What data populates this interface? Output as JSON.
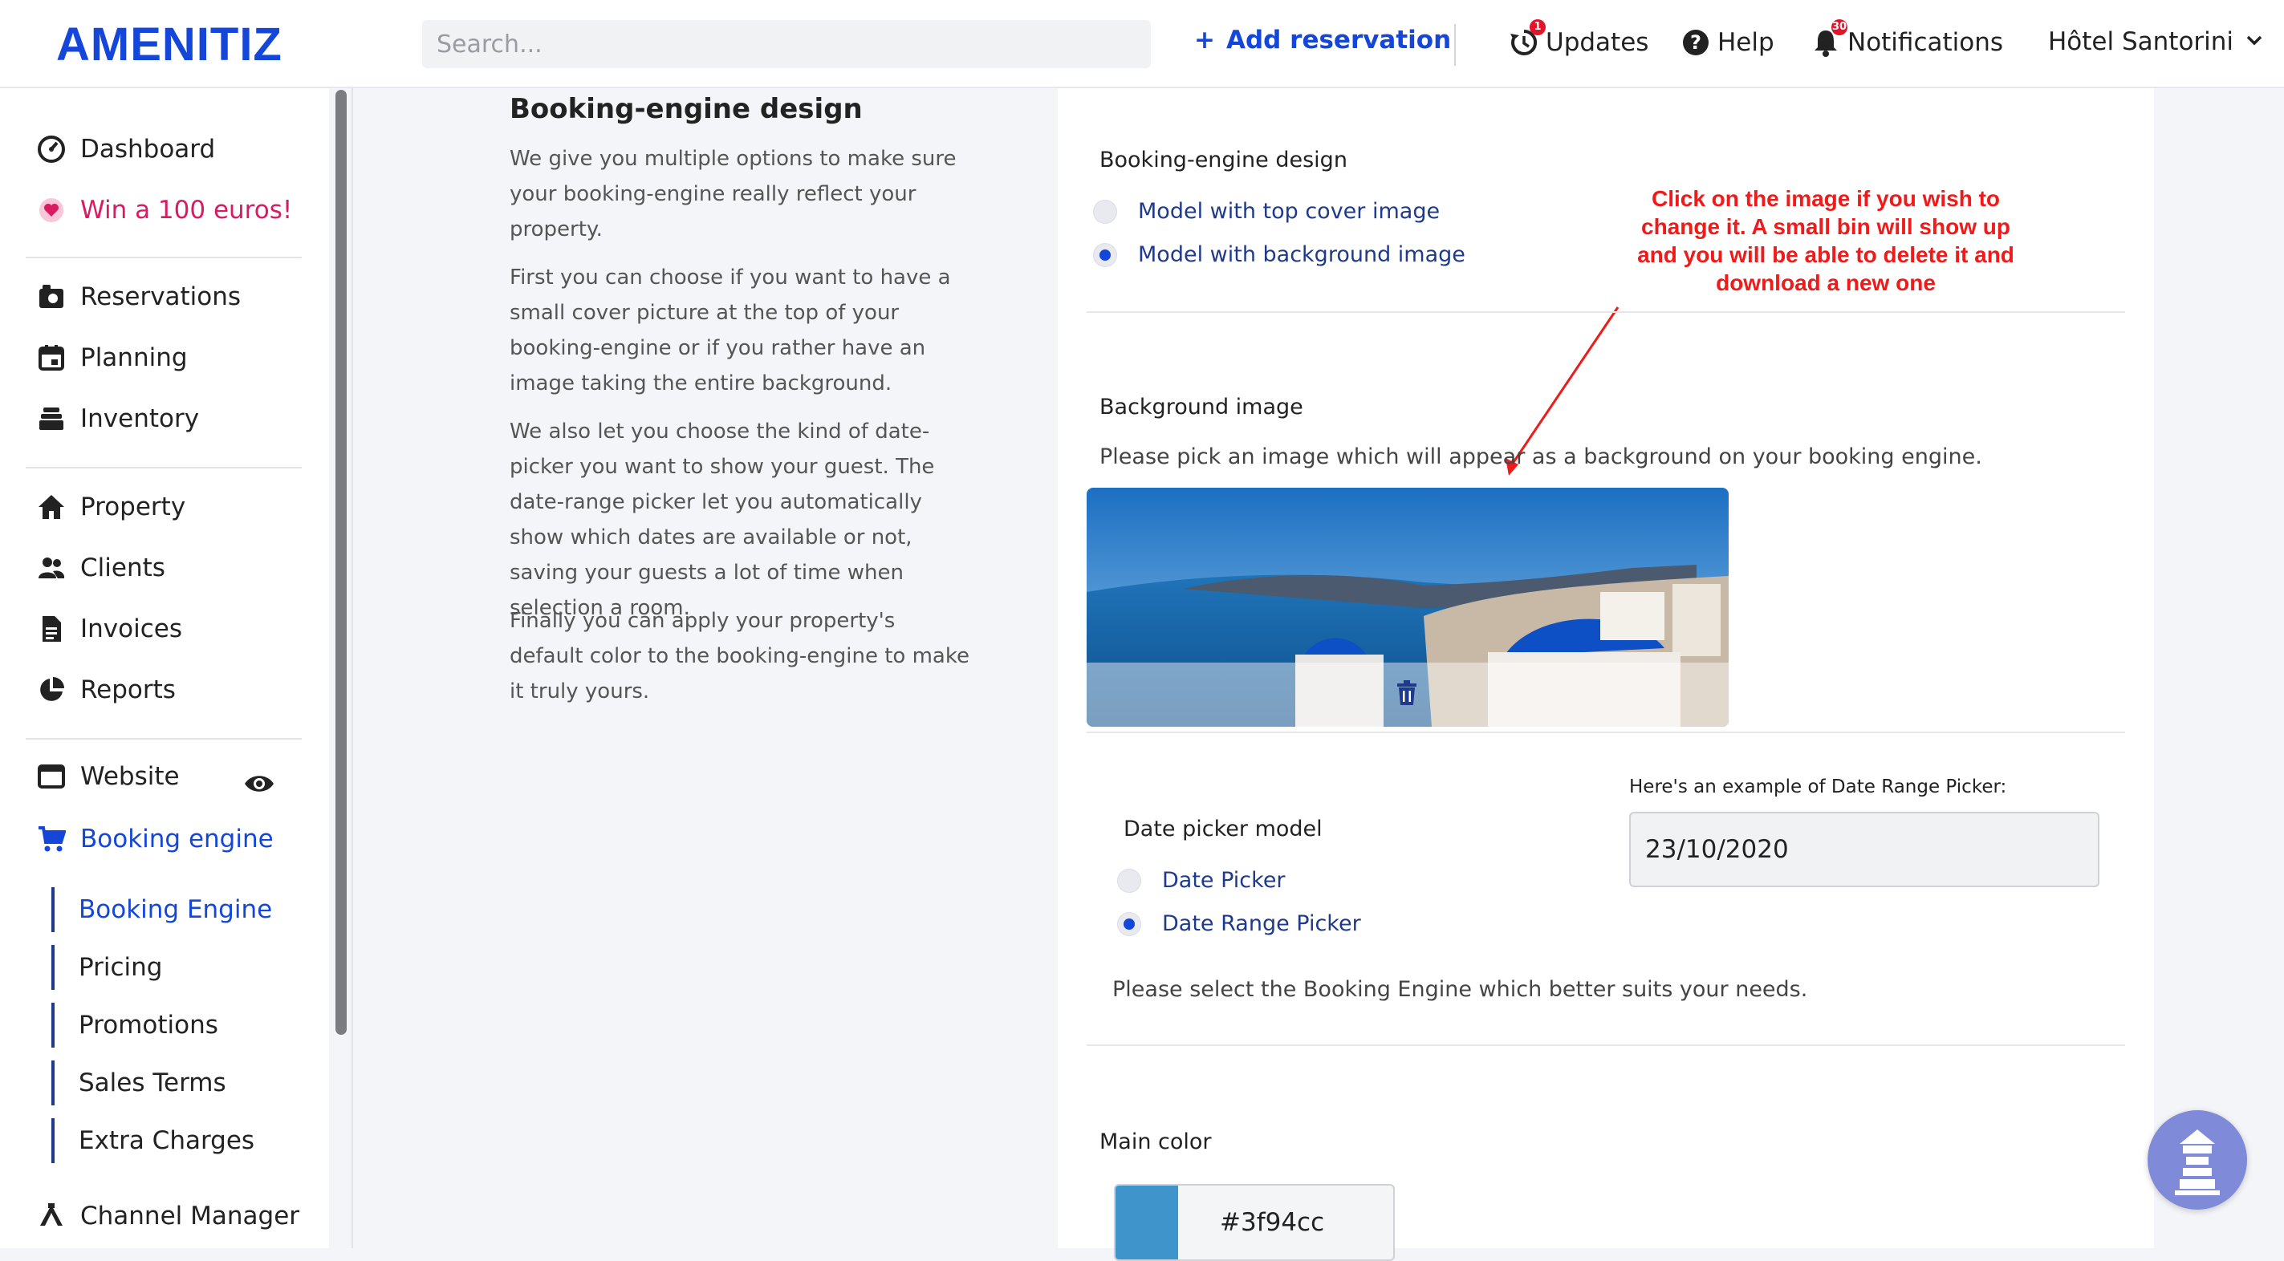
{
  "brand": {
    "logo_text": "AMENITIZ",
    "color": "#1446d9"
  },
  "topbar": {
    "search_placeholder": "Search...",
    "add_reservation": "Add reservation",
    "updates": {
      "label": "Updates",
      "badge": "1"
    },
    "help": "Help",
    "notifications": {
      "label": "Notifications",
      "badge": "30"
    },
    "hotel": "Hôtel Santorini"
  },
  "sidebar": {
    "dashboard": "Dashboard",
    "win": "Win a 100 euros!",
    "reservations": "Reservations",
    "planning": "Planning",
    "inventory": "Inventory",
    "property": "Property",
    "clients": "Clients",
    "invoices": "Invoices",
    "reports": "Reports",
    "website": "Website",
    "booking_engine": "Booking engine",
    "sub": {
      "booking_engine": "Booking Engine",
      "pricing": "Pricing",
      "promotions": "Promotions",
      "sales_terms": "Sales Terms",
      "extra_charges": "Extra Charges"
    },
    "channel_manager": "Channel Manager"
  },
  "description": {
    "title": "Booking-engine design",
    "p1": "We give you multiple options to make sure your booking-engine really reflect your property.",
    "p2": "First you can choose if you want to have a small cover picture at the top of your booking-engine or if you rather have an image taking the entire background.",
    "p3": "We also let you choose the kind of date-picker you want to show your guest. The date-range picker let you automatically show which dates are available or not, saving your guests a lot of time when selection a room.",
    "p4": "Finally you can apply your property's default color to the booking-engine to make it truly yours."
  },
  "design": {
    "label": "Booking-engine design",
    "option_top": "Model with top cover image",
    "option_bg": "Model with background image",
    "selected": "Model with background image"
  },
  "annotation": "Click on the image if you wish to change it. A small bin will show up and you will be able to delete it and download a new one",
  "background": {
    "label": "Background image",
    "help": "Please pick an image which will appear as a background on your booking engine."
  },
  "datepicker": {
    "label": "Date picker model",
    "option_single": "Date Picker",
    "option_range": "Date Range Picker",
    "selected": "Date Range Picker",
    "example_label": "Here's an example of Date Range Picker:",
    "example_value": "23/10/2020",
    "help": "Please select the Booking Engine which better suits your needs."
  },
  "main_color": {
    "label": "Main color",
    "value": "#3f94cc"
  },
  "colors": {
    "annotation_red": "#ef1a1a",
    "link_blue": "#1446d9",
    "radio_text": "#1f3a8a",
    "pink": "#d81b63"
  }
}
